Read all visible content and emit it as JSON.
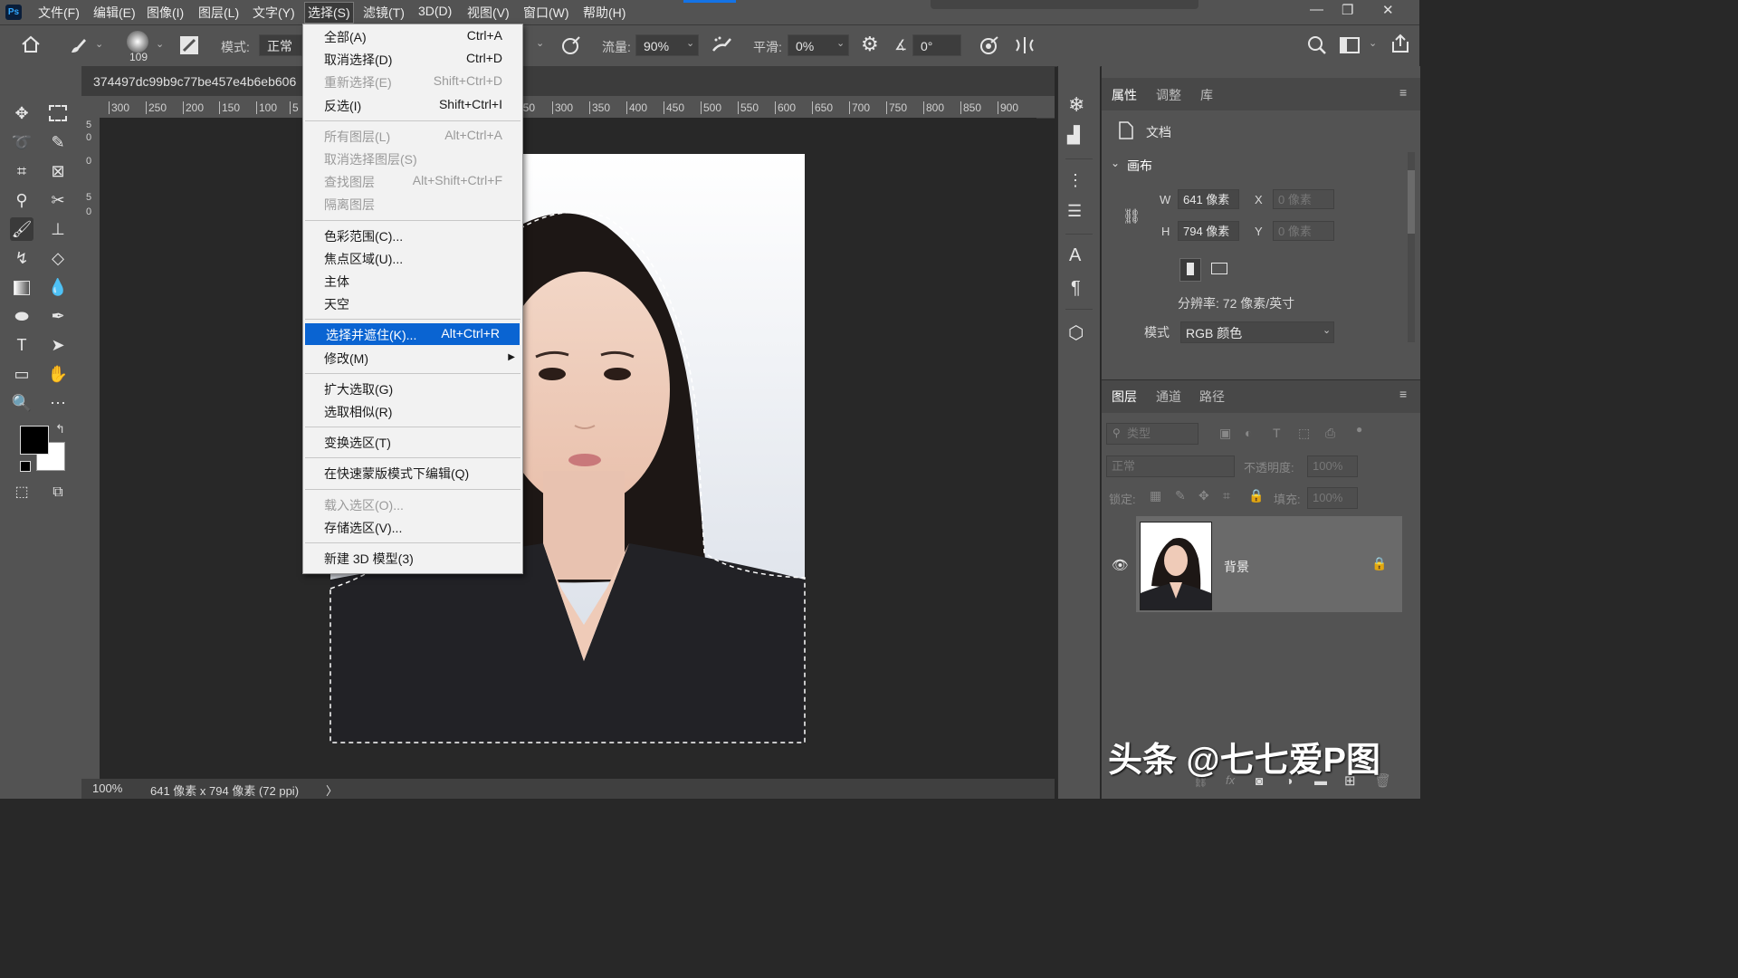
{
  "menubar": {
    "items": [
      "文件(F)",
      "编辑(E)",
      "图像(I)",
      "图层(L)",
      "文字(Y)",
      "选择(S)",
      "滤镜(T)",
      "3D(D)",
      "视图(V)",
      "窗口(W)",
      "帮助(H)"
    ],
    "logo": "Ps"
  },
  "options": {
    "brush_size": "109",
    "mode_label": "模式:",
    "mode_value": "正常",
    "flow_label": "流量:",
    "flow_value": "90%",
    "smooth_label": "平滑:",
    "smooth_value": "0%",
    "angle_value": "0°"
  },
  "document": {
    "tab_title": "374497dc99b9c77be457e4b6eb606",
    "ruler_h": [
      "300",
      "250",
      "200",
      "150",
      "100",
      "5",
      "250",
      "300",
      "350",
      "400",
      "450",
      "500",
      "550",
      "600",
      "650",
      "700",
      "750",
      "800",
      "850",
      "900"
    ],
    "ruler_v": [
      "5",
      "0",
      "0",
      "5",
      "0"
    ],
    "zoom": "100%",
    "size_info": "641 像素 x 794 像素 (72 ppi)",
    "status_arrow": "〉"
  },
  "select_menu": {
    "groups": [
      [
        {
          "label": "全部(A)",
          "key": "Ctrl+A",
          "disabled": false
        },
        {
          "label": "取消选择(D)",
          "key": "Ctrl+D",
          "disabled": false
        },
        {
          "label": "重新选择(E)",
          "key": "Shift+Ctrl+D",
          "disabled": true
        },
        {
          "label": "反选(I)",
          "key": "Shift+Ctrl+I",
          "disabled": false
        }
      ],
      [
        {
          "label": "所有图层(L)",
          "key": "Alt+Ctrl+A",
          "disabled": true
        },
        {
          "label": "取消选择图层(S)",
          "key": "",
          "disabled": true
        },
        {
          "label": "查找图层",
          "key": "Alt+Shift+Ctrl+F",
          "disabled": true
        },
        {
          "label": "隔离图层",
          "key": "",
          "disabled": true
        }
      ],
      [
        {
          "label": "色彩范围(C)...",
          "key": "",
          "disabled": false
        },
        {
          "label": "焦点区域(U)...",
          "key": "",
          "disabled": false
        },
        {
          "label": "主体",
          "key": "",
          "disabled": false
        },
        {
          "label": "天空",
          "key": "",
          "disabled": false
        }
      ],
      [
        {
          "label": "选择并遮住(K)...",
          "key": "Alt+Ctrl+R",
          "disabled": false,
          "highlighted": true
        },
        {
          "label": "修改(M)",
          "key": "",
          "disabled": false,
          "submenu": true
        }
      ],
      [
        {
          "label": "扩大选取(G)",
          "key": "",
          "disabled": false
        },
        {
          "label": "选取相似(R)",
          "key": "",
          "disabled": false
        }
      ],
      [
        {
          "label": "变换选区(T)",
          "key": "",
          "disabled": false
        }
      ],
      [
        {
          "label": "在快速蒙版模式下编辑(Q)",
          "key": "",
          "disabled": false
        }
      ],
      [
        {
          "label": "载入选区(O)...",
          "key": "",
          "disabled": true
        },
        {
          "label": "存储选区(V)...",
          "key": "",
          "disabled": false
        }
      ],
      [
        {
          "label": "新建 3D 模型(3)",
          "key": "",
          "disabled": false
        }
      ]
    ],
    "submenu_arrow": "▶"
  },
  "properties": {
    "tabs": [
      "属性",
      "调整",
      "库"
    ],
    "doc_label": "文档",
    "canvas_label": "画布",
    "w_label": "W",
    "w_value": "641 像素",
    "h_label": "H",
    "h_value": "794 像素",
    "x_label": "X",
    "x_value": "0 像素",
    "y_label": "Y",
    "y_value": "0 像素",
    "resolution": "分辨率: 72 像素/英寸",
    "mode_label": "模式",
    "mode_value": "RGB 颜色"
  },
  "layers": {
    "tabs": [
      "图层",
      "通道",
      "路径"
    ],
    "filter_placeholder": "类型",
    "blend_mode": "正常",
    "opacity_label": "不透明度:",
    "opacity_value": "100%",
    "lock_label": "锁定:",
    "fill_label": "填充:",
    "fill_value": "100%",
    "layer_name": "背景"
  },
  "watermark": "头条 @七七爱P图",
  "colors": {
    "accent": "#0a64d2",
    "panel": "#535353",
    "canvas_bg": "#282828"
  }
}
